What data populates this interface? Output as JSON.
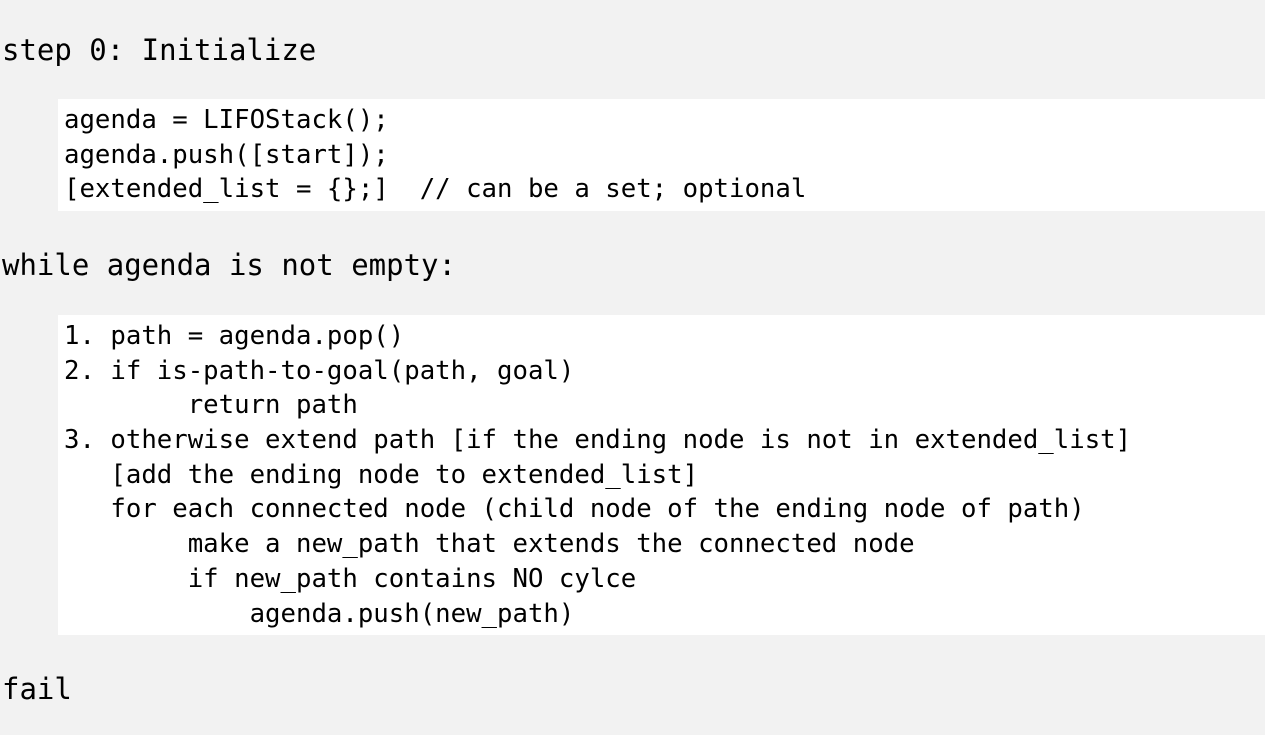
{
  "step0": {
    "heading": "step 0: Initialize",
    "lines": [
      "agenda = LIFOStack();",
      "agenda.push([start]);",
      "[extended_list = {};]  // can be a set; optional"
    ]
  },
  "loop": {
    "heading": "while agenda is not empty:",
    "lines": [
      "1. path = agenda.pop()",
      "2. if is-path-to-goal(path, goal)",
      "        return path",
      "3. otherwise extend path [if the ending node is not in extended_list]",
      "   [add the ending node to extended_list]",
      "   for each connected node (child node of the ending node of path)",
      "        make a new_path that extends the connected node",
      "        if new_path contains NO cylce",
      "            agenda.push(new_path)"
    ]
  },
  "fail": {
    "heading": "fail"
  }
}
